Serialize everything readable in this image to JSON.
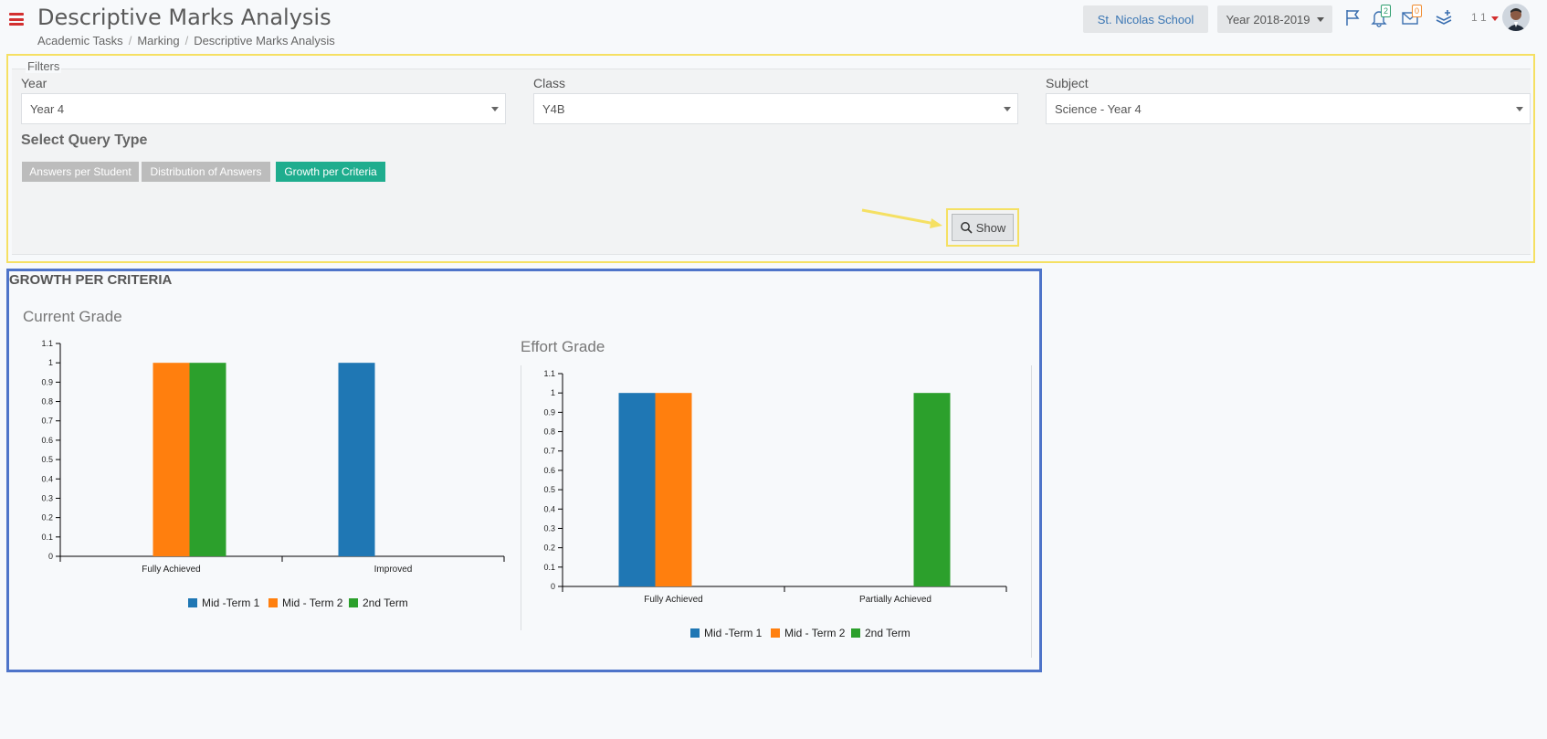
{
  "header": {
    "page_title": "Descriptive Marks Analysis",
    "breadcrumb": [
      "Academic Tasks",
      "Marking",
      "Descriptive Marks Analysis"
    ],
    "school_button": "St. Nicolas School",
    "year_selector": "Year 2018-2019",
    "notifications_count": "2",
    "messages_count": "0",
    "user_label": "1 1",
    "icons": [
      "menu-icon",
      "flag-icon",
      "bell-icon",
      "envelope-icon",
      "layers-add-icon",
      "avatar"
    ]
  },
  "filters": {
    "legend": "Filters",
    "year": {
      "label": "Year",
      "value": "Year 4"
    },
    "class": {
      "label": "Class",
      "value": "Y4B"
    },
    "subject": {
      "label": "Subject",
      "value": "Science - Year 4"
    },
    "query_type_label": "Select Query Type",
    "query_types": [
      {
        "label": "Answers per Student",
        "active": false
      },
      {
        "label": "Distribution of Answers",
        "active": false
      },
      {
        "label": "Growth per Criteria",
        "active": true
      }
    ],
    "show_button": "Show"
  },
  "results": {
    "section_title": "GROWTH PER CRITERIA"
  },
  "colors": {
    "series1": "#1f77b4",
    "series2": "#ff7f0e",
    "series3": "#2ca02c",
    "active_query": "#1fad8e",
    "inactive_query": "#bcbcbc",
    "highlight_yellow": "#f5e063",
    "highlight_blue": "#4e74c9"
  },
  "chart_data": [
    {
      "type": "bar",
      "title": "Current Grade",
      "categories": [
        "Fully Achieved",
        "Improved"
      ],
      "series": [
        {
          "name": "Mid -Term 1",
          "values": [
            0,
            1
          ]
        },
        {
          "name": "Mid - Term 2",
          "values": [
            1,
            0
          ]
        },
        {
          "name": "2nd Term",
          "values": [
            1,
            0
          ]
        }
      ],
      "ylim": [
        0,
        1.1
      ],
      "yticks": [
        "0",
        "0.1",
        "0.2",
        "0.3",
        "0.4",
        "0.5",
        "0.6",
        "0.7",
        "0.8",
        "0.9",
        "1",
        "1.1"
      ],
      "legend_position": "bottom"
    },
    {
      "type": "bar",
      "title": "Effort Grade",
      "categories": [
        "Fully Achieved",
        "Partially Achieved"
      ],
      "series": [
        {
          "name": "Mid -Term 1",
          "values": [
            1,
            0
          ]
        },
        {
          "name": "Mid - Term 2",
          "values": [
            1,
            0
          ]
        },
        {
          "name": "2nd Term",
          "values": [
            0,
            1
          ]
        }
      ],
      "ylim": [
        0,
        1.1
      ],
      "yticks": [
        "0",
        "0.1",
        "0.2",
        "0.3",
        "0.4",
        "0.5",
        "0.6",
        "0.7",
        "0.8",
        "0.9",
        "1",
        "1.1"
      ],
      "legend_position": "bottom"
    }
  ]
}
